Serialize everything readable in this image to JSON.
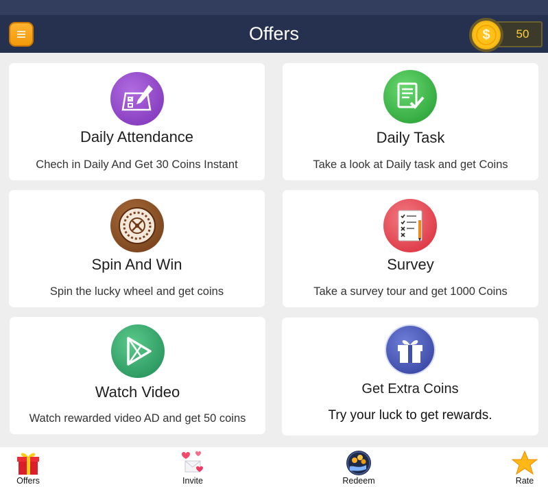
{
  "appbar": {
    "title": "Offers",
    "coins": "50",
    "coin_symbol": "$"
  },
  "offers": [
    {
      "title": "Daily Attendance",
      "description": "Chech in Daily And Get 30 Coins Instant",
      "icon": "attendance-icon",
      "color": "#8a3fc4"
    },
    {
      "title": "Daily Task",
      "description": "Take a look at Daily task and get Coins",
      "icon": "task-checklist-icon",
      "color": "#2eaa3c"
    },
    {
      "title": "Spin And Win",
      "description": "Spin the lucky wheel and get coins",
      "icon": "roulette-wheel-icon",
      "color": "#8b4f22"
    },
    {
      "title": "Survey",
      "description": "Take a survey tour and get 1000 Coins",
      "icon": "survey-clipboard-icon",
      "color": "#e23a45"
    },
    {
      "title": "Watch Video",
      "description": "Watch rewarded video AD and get 50 coins",
      "icon": "play-video-icon",
      "color": "#2e9a68"
    },
    {
      "title": "Get Extra Coins",
      "description": "Try your luck to get rewards.",
      "icon": "gift-icon",
      "color": "#3f4fb0"
    }
  ],
  "nav": [
    {
      "label": "Offers",
      "icon": "gift-box-icon"
    },
    {
      "label": "Invite",
      "icon": "invite-hearts-icon"
    },
    {
      "label": "Redeem",
      "icon": "redeem-coins-icon"
    },
    {
      "label": "Rate",
      "icon": "star-icon"
    }
  ]
}
